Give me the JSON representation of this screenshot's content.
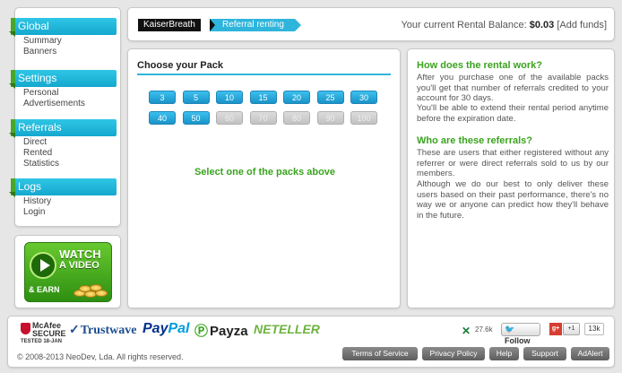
{
  "sidebar": {
    "sections": [
      {
        "title": "Global",
        "links": [
          "Summary",
          "Banners"
        ]
      },
      {
        "title": "Settings",
        "links": [
          "Personal",
          "Advertisements"
        ]
      },
      {
        "title": "Referrals",
        "links": [
          "Direct",
          "Rented",
          "Statistics"
        ]
      },
      {
        "title": "Logs",
        "links": [
          "History",
          "Login"
        ]
      }
    ]
  },
  "video_banner": {
    "line1": "WATCH",
    "line2": "A VIDEO",
    "earn": "& EARN"
  },
  "breadcrumb": {
    "home": "KaiserBreath",
    "current": "Referral renting"
  },
  "balance": {
    "label": "Your current Rental Balance:",
    "amount": "$0.03",
    "add_funds": "Add funds"
  },
  "packs": {
    "title": "Choose your Pack",
    "items": [
      {
        "value": "3",
        "enabled": true
      },
      {
        "value": "5",
        "enabled": true
      },
      {
        "value": "10",
        "enabled": true
      },
      {
        "value": "15",
        "enabled": true
      },
      {
        "value": "20",
        "enabled": true
      },
      {
        "value": "25",
        "enabled": true
      },
      {
        "value": "30",
        "enabled": true
      },
      {
        "value": "40",
        "enabled": true
      },
      {
        "value": "50",
        "enabled": true
      },
      {
        "value": "60",
        "enabled": false
      },
      {
        "value": "70",
        "enabled": false
      },
      {
        "value": "80",
        "enabled": false
      },
      {
        "value": "90",
        "enabled": false
      },
      {
        "value": "100",
        "enabled": false
      }
    ],
    "hint": "Select one of the packs above"
  },
  "info": {
    "q1": "How does the rental work?",
    "a1": "After you purchase one of the available packs you'll get that number of referrals credited to your account for 30 days.",
    "a1b": "You'll be able to extend their rental period anytime before the expiration date.",
    "q2": "Who are these referrals?",
    "a2": "These are users that either registered without any referrer or were direct referrals sold to us by our members.",
    "a2b": "Although we do our best to only deliver these users based on their past performance, there's no way we or anyone can predict how they'll behave in the future."
  },
  "footer": {
    "mcafee": "McAfee\nSECURE",
    "mcafee_tested": "TESTED  18-JAN",
    "trustwave": "Trustwave",
    "paypal_a": "Pay",
    "paypal_b": "Pal",
    "payza": "Payza",
    "neteller": "NETELLER",
    "copyright": "© 2008-2013 NeoDev, Lda. All rights reserved.",
    "x_count": "27.6k",
    "follow": "Follow",
    "gplus": "g+",
    "plusone": "+1",
    "plusone_count": "13k",
    "buttons": [
      "Terms of Service",
      "Privacy Policy",
      "Help",
      "Support",
      "AdAlert"
    ]
  }
}
